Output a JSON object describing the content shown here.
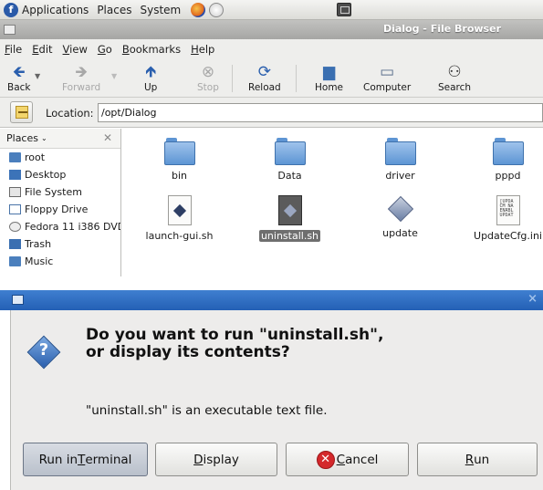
{
  "panel": {
    "menus": [
      "Applications",
      "Places",
      "System"
    ]
  },
  "file_browser": {
    "title": "Dialog - File Browser",
    "menubar": [
      "File",
      "Edit",
      "View",
      "Go",
      "Bookmarks",
      "Help"
    ],
    "toolbar": {
      "back": "Back",
      "forward": "Forward",
      "up": "Up",
      "stop": "Stop",
      "reload": "Reload",
      "home": "Home",
      "computer": "Computer",
      "search": "Search"
    },
    "location": {
      "label": "Location:",
      "value": "/opt/Dialog"
    },
    "sidebar": {
      "header": "Places",
      "items": [
        "root",
        "Desktop",
        "File System",
        "Floppy Drive",
        "Fedora 11 i386 DVD",
        "Trash",
        "Music"
      ]
    },
    "files": [
      {
        "name": "bin",
        "kind": "folder"
      },
      {
        "name": "Data",
        "kind": "folder"
      },
      {
        "name": "driver",
        "kind": "folder"
      },
      {
        "name": "pppd",
        "kind": "folder"
      },
      {
        "name": "launch-gui.sh",
        "kind": "script"
      },
      {
        "name": "uninstall.sh",
        "kind": "script",
        "selected": true
      },
      {
        "name": "update",
        "kind": "executable"
      },
      {
        "name": "UpdateCfg.ini",
        "kind": "ini"
      }
    ],
    "ini_preview_text": "[UPDA\nCM_NA\nENABL\nUPDAT"
  },
  "dialog": {
    "heading": "Do you want to run \"uninstall.sh\", or display its contents?",
    "message": "\"uninstall.sh\" is an executable text file.",
    "buttons": {
      "run_in_terminal": {
        "before": "Run in ",
        "mnemonic": "T",
        "after": "erminal"
      },
      "display": {
        "before": "",
        "mnemonic": "D",
        "after": "isplay"
      },
      "cancel": {
        "before": "",
        "mnemonic": "C",
        "after": "ancel"
      },
      "run": {
        "before": "",
        "mnemonic": "R",
        "after": "un"
      }
    },
    "close_glyph": "×"
  },
  "colors": {
    "dialog_titlebar": "#2d6cc1",
    "selection": "#6f6f6f",
    "cancel_icon": "#d4282b"
  }
}
